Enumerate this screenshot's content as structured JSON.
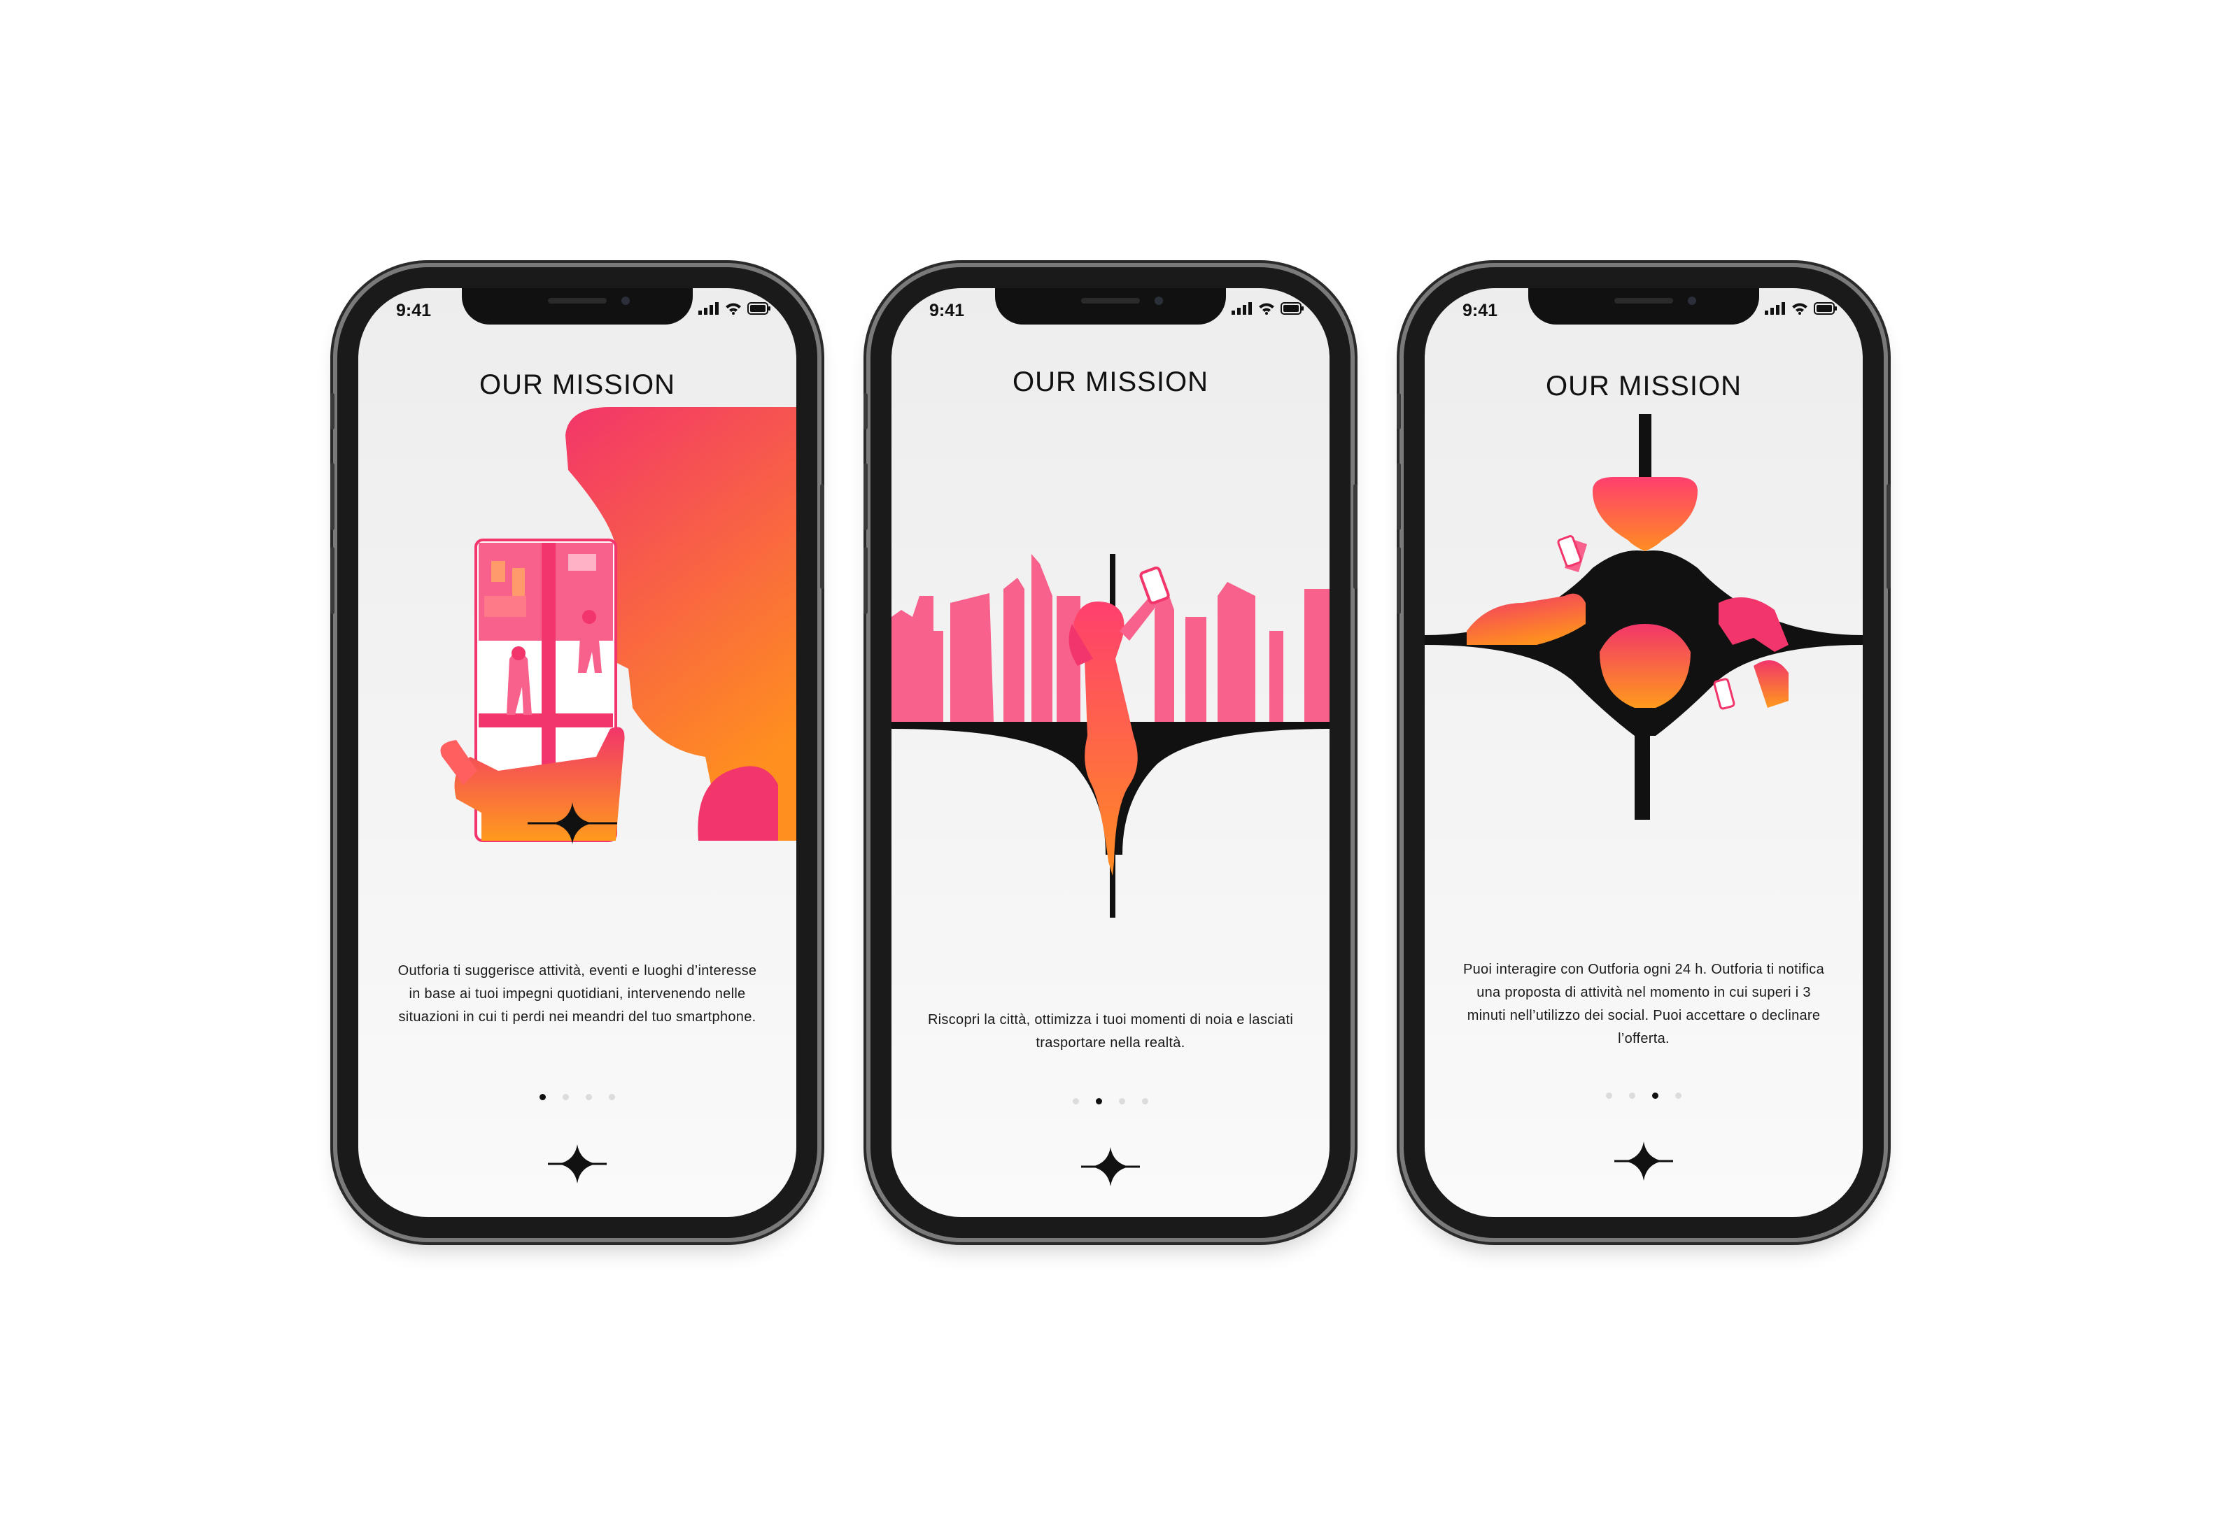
{
  "status_bar": {
    "time": "9:41"
  },
  "screens": [
    {
      "title": "OUR MISSION",
      "description": "Outforia ti suggerisce attività, eventi e luoghi d’interesse in base ai tuoi impegni quotidiani, intervenendo nelle situazioni in cui ti perdi nei meandri del tuo smartphone.",
      "active_page": 1,
      "page_count": 4
    },
    {
      "title": "OUR MISSION",
      "description": "Riscopri la città, ottimizza i tuoi momenti di noia e lasciati trasportare nella realtà.",
      "active_page": 2,
      "page_count": 4
    },
    {
      "title": "OUR MISSION",
      "description": "Puoi interagire con Outforia ogni 24 h. Outforia ti notifica una proposta di attività nel momento in cui superi i 3 minuti nell’utilizzo dei social. Puoi accettare o declinare l’offerta.",
      "active_page": 3,
      "page_count": 4
    }
  ],
  "icons": [
    "signal-icon",
    "wifi-icon",
    "battery-icon",
    "four-point-star-icon"
  ],
  "colors": {
    "gradient_pink": "#f2356a",
    "gradient_orange": "#ff8f1f",
    "light_pink": "#f7618c",
    "ink": "#111111"
  }
}
